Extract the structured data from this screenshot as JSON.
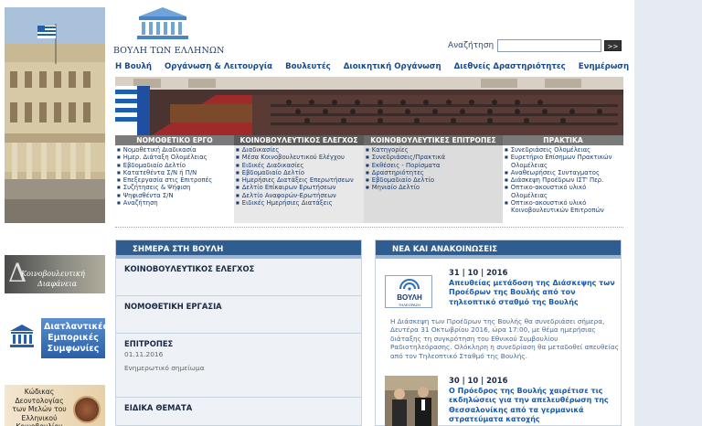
{
  "logo": {
    "text": "ΒΟΥΛΗ ΤΩΝ ΕΛΛΗΝΩΝ"
  },
  "search": {
    "label": "Αναζήτηση",
    "placeholder": "",
    "button": ">>"
  },
  "nav": {
    "items": [
      "Η Βουλή",
      "Οργάνωση & Λειτουργία",
      "Βουλευτές",
      "Διοικητική Οργάνωση",
      "Διεθνείς Δραστηριότητες",
      "Ενημέρωση"
    ]
  },
  "categories": {
    "legislative": {
      "title": "ΝΟΜΟΘΕΤΙΚΟ ΕΡΓΟ",
      "items": [
        "Νομοθετική Διαδικασία",
        "Ημερ. Διάταξη Ολομέλειας",
        "Εβδομαδιαίο Δελτίο",
        "Κατατεθέντα Σ/Ν ή Π/Ν",
        "Επεξεργασία στις Επιτροπές",
        "Συζήτησεις & Ψήφιση",
        "Ψηφισθέντα Σ/Ν",
        "Αναζήτηση"
      ]
    },
    "control": {
      "title": "ΚΟΙΝΟΒΟΥΛΕΥΤΙΚΟΣ ΕΛΕΓΧΟΣ",
      "items": [
        "Διαδικασίες",
        "Μέσα Κοινοβουλευτικού Ελέγχου",
        "Ειδικές Διαδικασίες",
        "Εβδομαδιαίο Δελτίο",
        "Ημερήσιες Διατάξεις Επερωτήσεων",
        "Δελτίο Επίκαιρων Ερωτήσεων",
        "Δελτίο Αναφορών-Ερωτήσεων",
        "Ειδικές Ημερήσιες Διατάξεις"
      ]
    },
    "committees": {
      "title": "ΚΟΙΝΟΒΟΥΛΕΥΤΙΚΕΣ ΕΠΙΤΡΟΠΕΣ",
      "items": [
        "Κατηγορίες",
        "Συνεδριάσεις/Πρακτικά",
        "Εκθέσεις - Πορίσματα",
        "Δραστηριότητες",
        "Εβδομαδιαίο Δελτίο",
        "Μηνιαίο Δελτίο"
      ]
    },
    "minutes": {
      "title": "ΠΡΑΚΤΙΚΑ",
      "items": [
        "Συνεδριάσεις Ολομέλειας",
        "Ευρετήριο Επίσημων Πρακτικών",
        "Ολομέλειας",
        "Αναθεωρήσεις Συνταγματος",
        "Διάσκεψη Προέδρων ΙΣΤ' Περ.",
        "Οπτικο-ακουστικό υλικό",
        "Ολομέλειας",
        "Οπτικο-ακουστικό υλικό",
        "Κοινοβουλευτικών Επιτροπών"
      ]
    }
  },
  "banners": {
    "transparency": {
      "letter": "Δ",
      "line1": "Κοινοβουλευτική",
      "line2": "Διαφάνεια"
    },
    "agreements": {
      "text": "Διατλαντικές Εμπορικές Συμφωνίες"
    },
    "ethics": {
      "text": "Κώδικας Δεοντολογίας των Μελών του Ελληνικού Κοινοβουλίου"
    }
  },
  "today": {
    "title": "ΣΗΜΕΡΑ ΣΤΗ ΒΟΥΛΗ",
    "items": [
      {
        "title": "ΚΟΙΝΟΒΟΥΛΕΥΤΙΚΟΣ ΕΛΕΓΧΟΣ"
      },
      {
        "title": "ΝΟΜΟΘΕΤΙΚΗ ΕΡΓΑΣΙΑ"
      },
      {
        "title": "ΕΠΙΤΡΟΠΕΣ",
        "date": "01.11.2016",
        "note": "Ενημερωτικό σημείωμα"
      },
      {
        "title": "ΕΙΔΙΚΑ ΘΕΜΑΤΑ"
      }
    ]
  },
  "news": {
    "title": "ΝΕΑ ΚΑΙ ΑΝΑΚΟΙΝΩΣΕΙΣ",
    "items": [
      {
        "date": "31 | 10 | 2016",
        "thumb_title": "ΒΟΥΛΗ",
        "thumb_sub": "ΤΗΛΕΟΡΑΣΗ",
        "headline": "Απευθείας μετάδοση της Διάσκεψης των Προέδρων της Βουλής από τον τηλεοπτικό σταθμό της Βουλής",
        "body": "Η Διάσκεψη των Προέδρων της Βουλής θα συνεδριάσει σήμερα, Δευτέρα 31 Οκτωβρίου 2016, ώρα 17:00, με θέμα ημερήσιας διάταξης τη συγκρότηση του Εθνικού Συμβουλίου Ραδιοτηλεόρασης. Ολόκληρη η συνεδρίαση θα μεταδοθεί απευθείας από τον Τηλεοπτικό Σταθμό της Βουλής."
      },
      {
        "date": "30 | 10 | 2016",
        "headline": "Ο Πρόεδρος της Βουλής χαιρέτισε τις εκδηλώσεις για την απελευθέρωση της Θεσσαλονίκης από τα γερμανικά στρατεύματα κατοχής"
      }
    ]
  }
}
